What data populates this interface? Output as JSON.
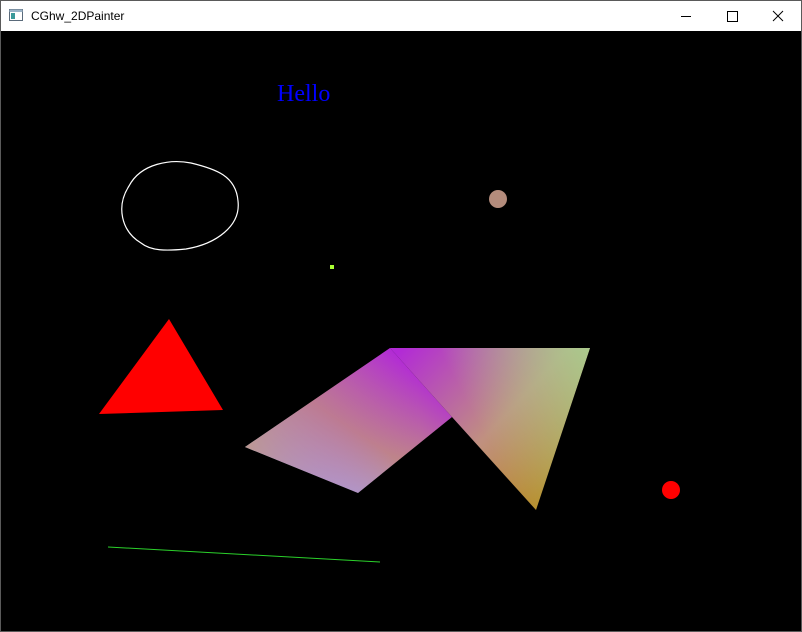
{
  "window": {
    "title": "CGhw_2DPainter",
    "icons": {
      "app": "window-app-icon",
      "minimize": "minimize-icon",
      "maximize": "maximize-icon",
      "close": "close-icon"
    }
  },
  "canvas": {
    "background": "#000000",
    "hello_text": "Hello",
    "hello_color": "#0000ff",
    "colors": {
      "outline": "#ffffff",
      "circle_tan": "#b48c7c",
      "point": "#aaff33",
      "triangle": "#ff0000",
      "dot_red": "#ff0000",
      "line": "#2bd12b",
      "gradient_magenta": "#b22ad6",
      "gradient_tan": "#c09080",
      "gradient_lightblue": "#a8c8f0",
      "gradient_green": "#a8d090",
      "gradient_orange": "#b88a18"
    }
  }
}
